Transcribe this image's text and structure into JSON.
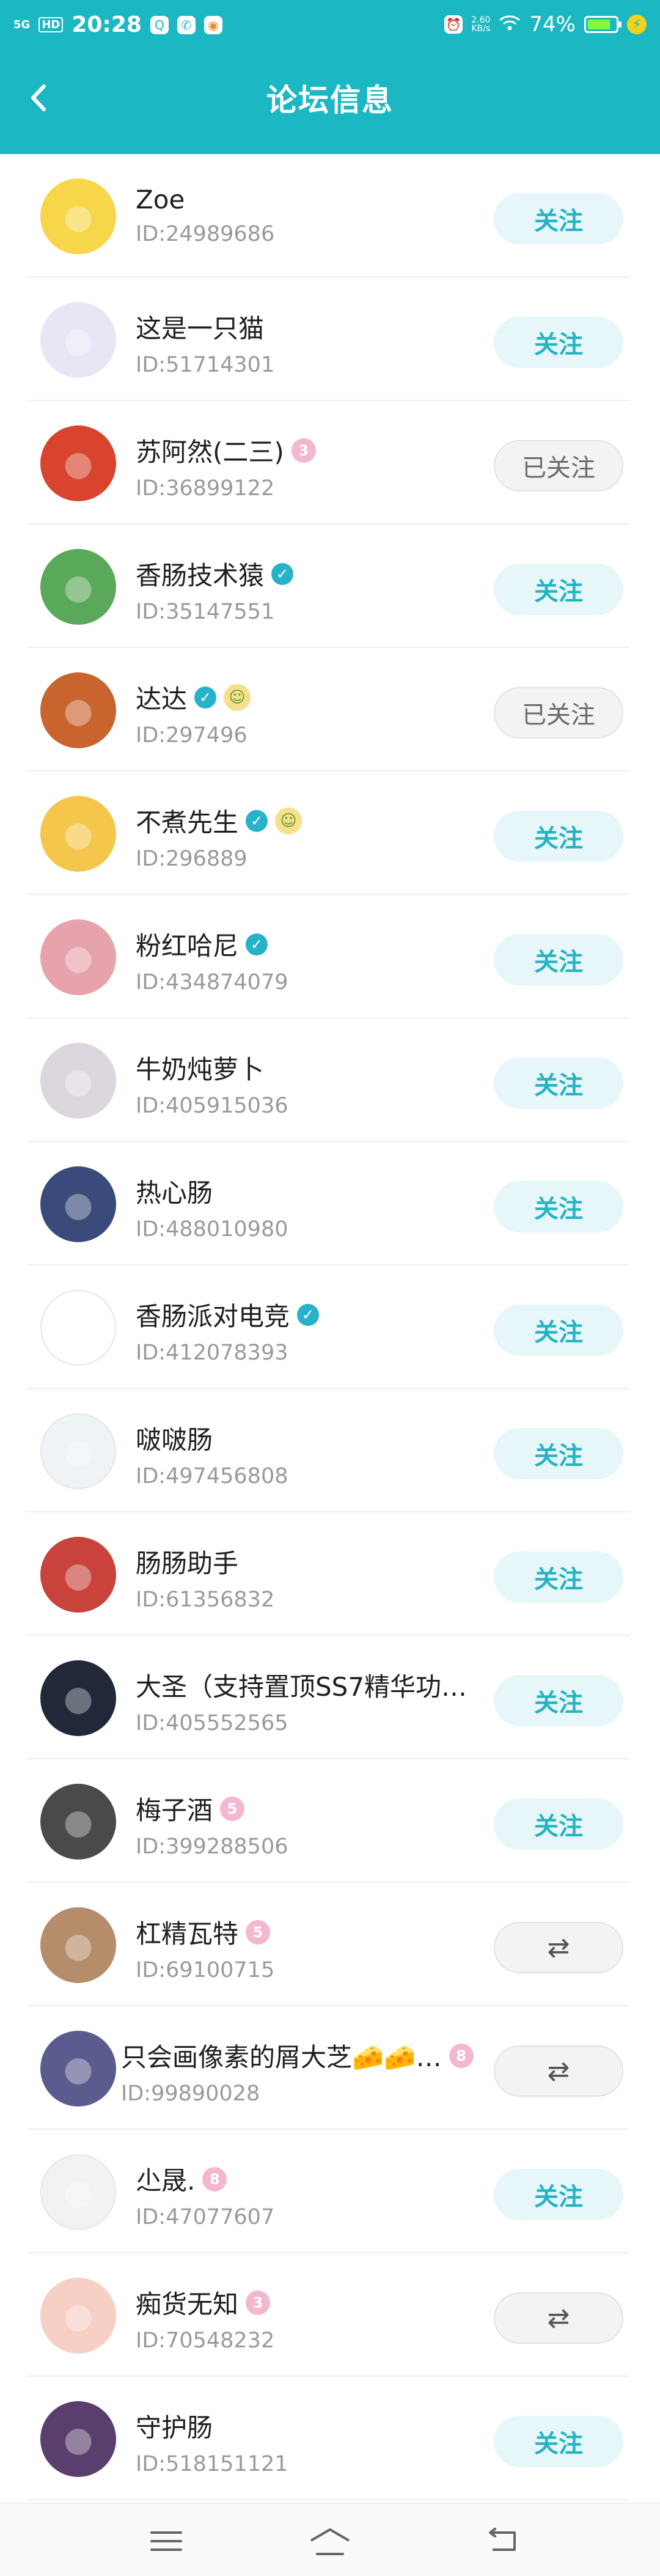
{
  "status_bar": {
    "network": "5G",
    "hd": "HD",
    "time": "20:28",
    "speed": "2.60\nKB/s",
    "battery": "74%",
    "battery_level": 0.74
  },
  "header": {
    "title": "论坛信息",
    "back_icon": "chevron-left-icon"
  },
  "users": [
    {
      "name": "Zoe",
      "id": "ID:24989686",
      "button": "关注",
      "state": "follow",
      "avatar_color": "#f7d64a",
      "badges": []
    },
    {
      "name": "这是一只猫",
      "id": "ID:51714301",
      "button": "关注",
      "state": "follow",
      "avatar_color": "#e9e5f4",
      "badges": []
    },
    {
      "name": "苏阿然(二三)",
      "id": "ID:36899122",
      "button": "已关注",
      "state": "followed",
      "avatar_color": "#d8442d",
      "badges": [
        "level"
      ],
      "level_text": "3"
    },
    {
      "name": "香肠技术猿",
      "id": "ID:35147551",
      "button": "关注",
      "state": "follow",
      "avatar_color": "#5aa85a",
      "badges": [
        "verified"
      ]
    },
    {
      "name": "达达",
      "id": "ID:297496",
      "button": "已关注",
      "state": "followed",
      "avatar_color": "#c9642e",
      "badges": [
        "verified",
        "medal"
      ]
    },
    {
      "name": "不煮先生",
      "id": "ID:296889",
      "button": "关注",
      "state": "follow",
      "avatar_color": "#f4c64c",
      "badges": [
        "verified",
        "medal"
      ]
    },
    {
      "name": "粉红哈尼",
      "id": "ID:434874079",
      "button": "关注",
      "state": "follow",
      "avatar_color": "#e7a3ab",
      "badges": [
        "verified"
      ]
    },
    {
      "name": "牛奶炖萝卜",
      "id": "ID:405915036",
      "button": "关注",
      "state": "follow",
      "avatar_color": "#ddd6de",
      "badges": []
    },
    {
      "name": "热心肠",
      "id": "ID:488010980",
      "button": "关注",
      "state": "follow",
      "avatar_color": "#3a4a7a",
      "badges": []
    },
    {
      "name": "香肠派对电竞",
      "id": "ID:412078393",
      "button": "关注",
      "state": "follow",
      "avatar_color": "#ffffff",
      "badges": [
        "verified"
      ]
    },
    {
      "name": "啵啵肠",
      "id": "ID:497456808",
      "button": "关注",
      "state": "follow",
      "avatar_color": "#eef3f6",
      "badges": []
    },
    {
      "name": "肠肠助手",
      "id": "ID:61356832",
      "button": "关注",
      "state": "follow",
      "avatar_color": "#c9423b",
      "badges": []
    },
    {
      "name": "大圣（支持置顶SS7精华功…",
      "id": "ID:405552565",
      "button": "关注",
      "state": "follow",
      "avatar_color": "#20283a",
      "badges": []
    },
    {
      "name": "梅子酒",
      "id": "ID:399288506",
      "button": "关注",
      "state": "follow",
      "avatar_color": "#4a4a4a",
      "badges": [
        "level"
      ],
      "level_text": "5"
    },
    {
      "name": "杠精瓦特",
      "id": "ID:69100715",
      "button": "⇄",
      "state": "mutual",
      "avatar_color": "#b68d6b",
      "badges": [
        "level"
      ],
      "level_text": "5"
    },
    {
      "name": "只会画像素的屑大芝🧀🧀…",
      "id": "ID:99890028",
      "button": "⇄",
      "state": "mutual",
      "avatar_color": "#5b5b8e",
      "badges": [
        "level"
      ],
      "level_text": "8",
      "wide": true
    },
    {
      "name": "尐晟.",
      "id": "ID:47077607",
      "button": "关注",
      "state": "follow",
      "avatar_color": "#f2f2f2",
      "badges": [
        "level"
      ],
      "level_text": "8"
    },
    {
      "name": "痴货无知",
      "id": "ID:70548232",
      "button": "⇄",
      "state": "mutual",
      "avatar_color": "#f7cfc4",
      "badges": [
        "level"
      ],
      "level_text": "3"
    },
    {
      "name": "守护肠",
      "id": "ID:518151121",
      "button": "关注",
      "state": "follow",
      "avatar_color": "#5a3f6e",
      "badges": []
    }
  ],
  "bottom_nav": {
    "menu_icon": "menu-icon",
    "home_icon": "home-icon",
    "back_icon": "back-arrow-icon"
  }
}
